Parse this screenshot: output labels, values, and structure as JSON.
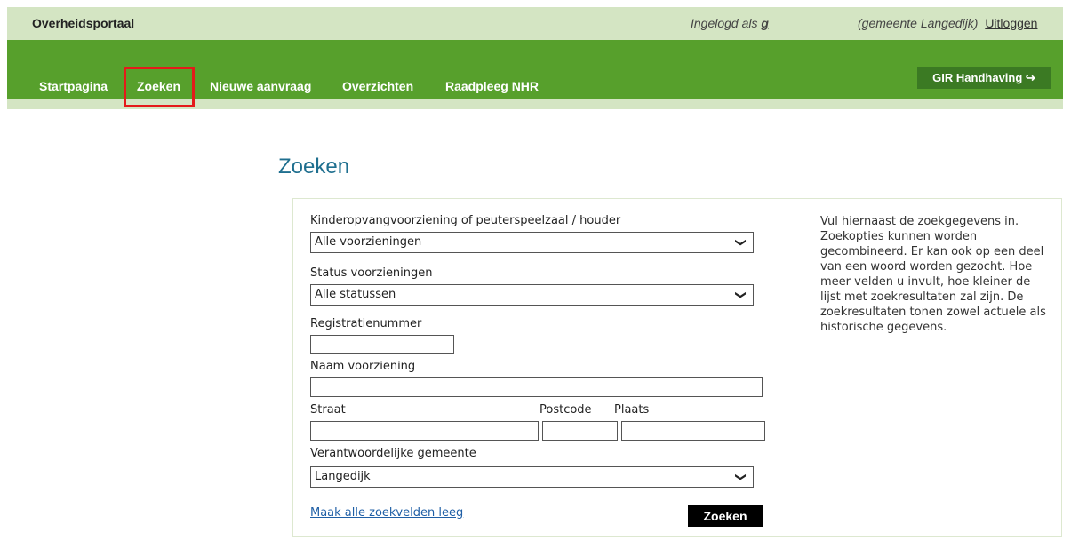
{
  "header": {
    "brand": "Overheidsportaal",
    "login_prefix": "Ingelogd als",
    "login_user": "g",
    "municipality": "(gemeente Langedijk)",
    "logout": "Uitloggen"
  },
  "nav": {
    "items": [
      "Startpagina",
      "Zoeken",
      "Nieuwe aanvraag",
      "Overzichten",
      "Raadpleeg NHR"
    ],
    "active": "Zoeken",
    "gir_button": "GIR Handhaving",
    "gir_icon": "exit-icon"
  },
  "page": {
    "title": "Zoeken"
  },
  "form": {
    "facility_label": "Kinderopvangvoorziening of peuterspeelzaal / houder",
    "facility_value": "Alle voorzieningen",
    "status_label": "Status voorzieningen",
    "status_value": "Alle statussen",
    "regnr_label": "Registratienummer",
    "regnr_value": "",
    "name_label": "Naam voorziening",
    "name_value": "",
    "street_label": "Straat",
    "postcode_label": "Postcode",
    "city_label": "Plaats",
    "municipality_label": "Verantwoordelijke gemeente",
    "municipality_value": "Langedijk",
    "clear_link": "Maak alle zoekvelden leeg",
    "search_button": "Zoeken"
  },
  "help_text": "Vul hiernaast de zoekgegevens in. Zoekopties kunnen worden gecombineerd. Er kan ook op een deel van een woord worden gezocht. Hoe meer velden u invult, hoe kleiner de lijst met zoekresultaten zal zijn. De zoekresultaten tonen zowel actuele als historische gegevens.",
  "colors": {
    "nav_green": "#57a02c",
    "light_green": "#d4e5c3",
    "title_blue": "#1f6f8f",
    "highlight_red": "#e41a1a"
  }
}
